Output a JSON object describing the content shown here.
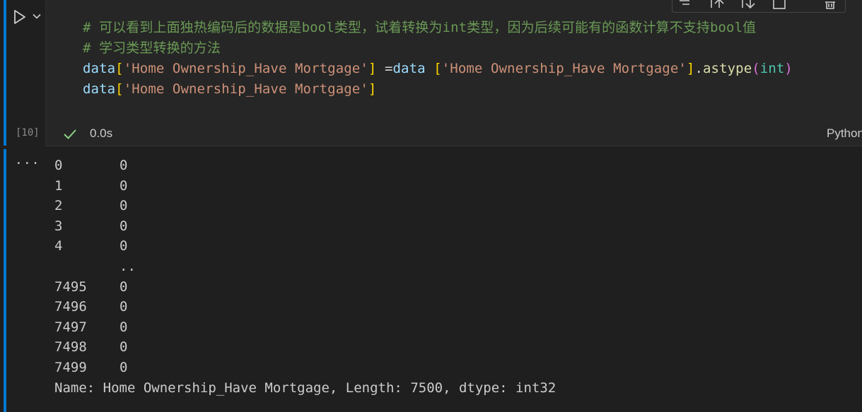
{
  "cell": {
    "execution_count": "[10]",
    "status_time": "0.0s",
    "kernel_language": "Python",
    "code_lines": [
      [
        {
          "t": "# 可以看到上面独热编码后的数据是bool类型，试着转换为int类型，因为后续可能有的函数计算不支持bool值",
          "c": "c-comment"
        }
      ],
      [
        {
          "t": "# 学习类型转换的方法",
          "c": "c-comment"
        }
      ],
      [
        {
          "t": "data",
          "c": "c-var"
        },
        {
          "t": "[",
          "c": "c-br1"
        },
        {
          "t": "'Home Ownership_Have Mortgage'",
          "c": "c-str"
        },
        {
          "t": "]",
          "c": "c-br1"
        },
        {
          "t": " =",
          "c": "c-op"
        },
        {
          "t": "data",
          "c": "c-var"
        },
        {
          "t": " ",
          "c": "c-op"
        },
        {
          "t": "[",
          "c": "c-br1"
        },
        {
          "t": "'Home Ownership_Have Mortgage'",
          "c": "c-str"
        },
        {
          "t": "]",
          "c": "c-br1"
        },
        {
          "t": ".",
          "c": "c-op"
        },
        {
          "t": "astype",
          "c": "c-fn"
        },
        {
          "t": "(",
          "c": "c-br2"
        },
        {
          "t": "int",
          "c": "c-type"
        },
        {
          "t": ")",
          "c": "c-br2"
        }
      ],
      [
        {
          "t": "data",
          "c": "c-var"
        },
        {
          "t": "[",
          "c": "c-br1"
        },
        {
          "t": "'Home Ownership_Have Mortgage'",
          "c": "c-str"
        },
        {
          "t": "]",
          "c": "c-br1"
        }
      ]
    ]
  },
  "output": {
    "more_label": "···",
    "rows": [
      {
        "index": "0",
        "value": "0"
      },
      {
        "index": "1",
        "value": "0"
      },
      {
        "index": "2",
        "value": "0"
      },
      {
        "index": "3",
        "value": "0"
      },
      {
        "index": "4",
        "value": "0"
      },
      {
        "index": "",
        "value": ".."
      },
      {
        "index": "7495",
        "value": "0"
      },
      {
        "index": "7496",
        "value": "0"
      },
      {
        "index": "7497",
        "value": "0"
      },
      {
        "index": "7498",
        "value": "0"
      },
      {
        "index": "7499",
        "value": "0"
      }
    ],
    "footer": "Name: Home Ownership_Have Mortgage, Length: 7500, dtype: int32"
  },
  "icons": {
    "run": "run-cell-icon",
    "chevron": "chevron-down-icon",
    "check": "check-icon",
    "toolbar": [
      "run-by-line-icon",
      "execute-above-icon",
      "execute-below-icon",
      "split-cell-icon",
      "delete-cell-icon"
    ]
  }
}
